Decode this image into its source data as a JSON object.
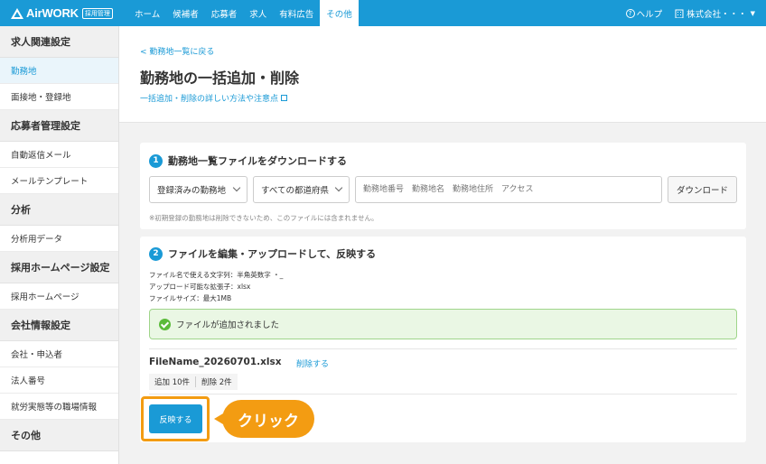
{
  "topbar": {
    "logo_text": "AirWORK",
    "logo_badge": "採用管理",
    "nav": [
      "ホーム",
      "候補者",
      "応募者",
      "求人",
      "有料広告",
      "その他"
    ],
    "help_label": "ヘルプ",
    "company_label": "株式会社・・・"
  },
  "sidebar": {
    "sections": [
      {
        "heading": "求人関連設定",
        "items": [
          "勤務地",
          "面接地・登録地"
        ]
      },
      {
        "heading": "応募者管理設定",
        "items": [
          "自動返信メール",
          "メールテンプレート"
        ]
      },
      {
        "heading": "分析",
        "items": [
          "分析用データ"
        ]
      },
      {
        "heading": "採用ホームページ設定",
        "items": [
          "採用ホームページ"
        ]
      },
      {
        "heading": "会社情報設定",
        "items": [
          "会社・申込者",
          "法人番号",
          "就労実態等の職場情報"
        ]
      },
      {
        "heading": "その他",
        "items": []
      }
    ]
  },
  "header": {
    "back_link": "勤務地一覧に戻る",
    "title": "勤務地の一括追加・削除",
    "detail_link": "一括追加・削除の詳しい方法や注意点"
  },
  "step1": {
    "num": "1",
    "title": "勤務地一覧ファイルをダウンロードする",
    "select1": "登録済みの勤務地",
    "select2": "すべての都道府県",
    "search_placeholder": "勤務地番号　勤務地名　勤務地住所　アクセス",
    "download_label": "ダウンロード",
    "note": "※初期登録の勤務地は削除できないため、このファイルには含まれません。"
  },
  "step2": {
    "num": "2",
    "title": "ファイルを編集・アップロードして、反映する",
    "info1": "ファイル名で使える文字列：半角英数字 ・_",
    "info2": "アップロード可能な拡張子：xlsx",
    "info3": "ファイルサイズ：最大1MB",
    "success_msg": "ファイルが追加されました",
    "file_name": "FileName_20260701.xlsx",
    "delete_link": "削除する",
    "added": "追加 10件",
    "deleted": "削除 2件",
    "apply_label": "反映する"
  },
  "callout": "クリック"
}
